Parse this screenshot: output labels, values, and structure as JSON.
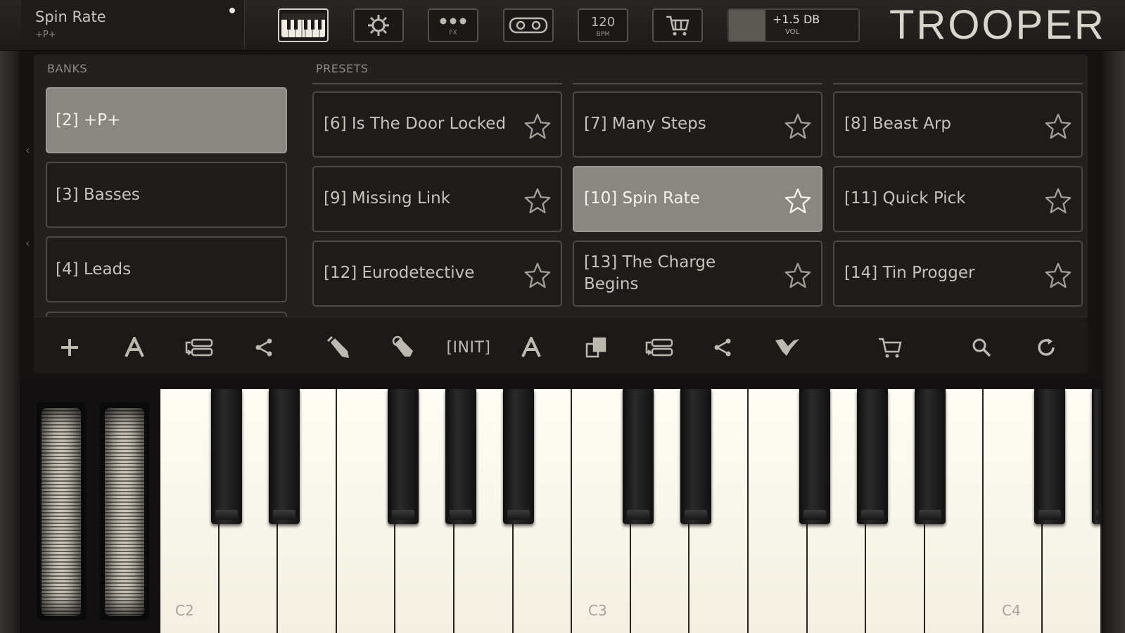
{
  "app": {
    "brand_small": "",
    "brand": "TROOPER"
  },
  "header": {
    "preset_title": "Spin Rate",
    "preset_subtitle": "+P+",
    "volume_value": "+1.5 DB",
    "volume_label": "VOL",
    "volume_level": 0.28,
    "buttons": [
      {
        "name": "keyboard-view-button",
        "icon": "keyboard-icon",
        "active": true
      },
      {
        "name": "settings-button",
        "icon": "gear-icon",
        "active": false
      },
      {
        "name": "fx-button",
        "icon": "fx-icon",
        "label": "FX",
        "active": false
      },
      {
        "name": "tape-button",
        "icon": "tape-icon",
        "active": false
      },
      {
        "name": "tempo-button",
        "icon": "tempo-icon",
        "value": "120",
        "label": "BPM",
        "active": false
      },
      {
        "name": "store-button",
        "icon": "cart-icon",
        "active": false
      }
    ]
  },
  "browser": {
    "banks_label": "BANKS",
    "presets_label": "PRESETS",
    "banks": [
      {
        "label": "[2] +P+",
        "selected": true
      },
      {
        "label": "[3] Basses",
        "selected": false
      },
      {
        "label": "[4] Leads",
        "selected": false
      }
    ],
    "presets": [
      {
        "label": "[6] Is The Door Locked",
        "selected": false
      },
      {
        "label": "[7] Many Steps",
        "selected": false
      },
      {
        "label": "[8] Beast Arp",
        "selected": false
      },
      {
        "label": "[9] Missing Link",
        "selected": false
      },
      {
        "label": "[10] Spin Rate",
        "selected": true
      },
      {
        "label": "[11] Quick Pick",
        "selected": false
      },
      {
        "label": "[12] Eurodetective",
        "selected": false
      },
      {
        "label": "[13] The Charge Begins",
        "selected": false
      },
      {
        "label": "[14] Tin Progger",
        "selected": false
      }
    ]
  },
  "toolbar": {
    "init_label": "[INIT]",
    "tools": [
      "add-bank-icon",
      "rename-bank-icon",
      "reorder-bank-icon",
      "share-bank-icon",
      "edit-preset-icon",
      "delete-preset-icon",
      "init-button",
      "rename-preset-icon",
      "copy-preset-icon",
      "move-preset-icon",
      "share-preset-icon",
      "random-preset-icon",
      "store-icon",
      "search-icon",
      "refresh-icon"
    ]
  },
  "keyboard": {
    "labels": [
      "C2",
      "C3",
      "C4"
    ]
  }
}
